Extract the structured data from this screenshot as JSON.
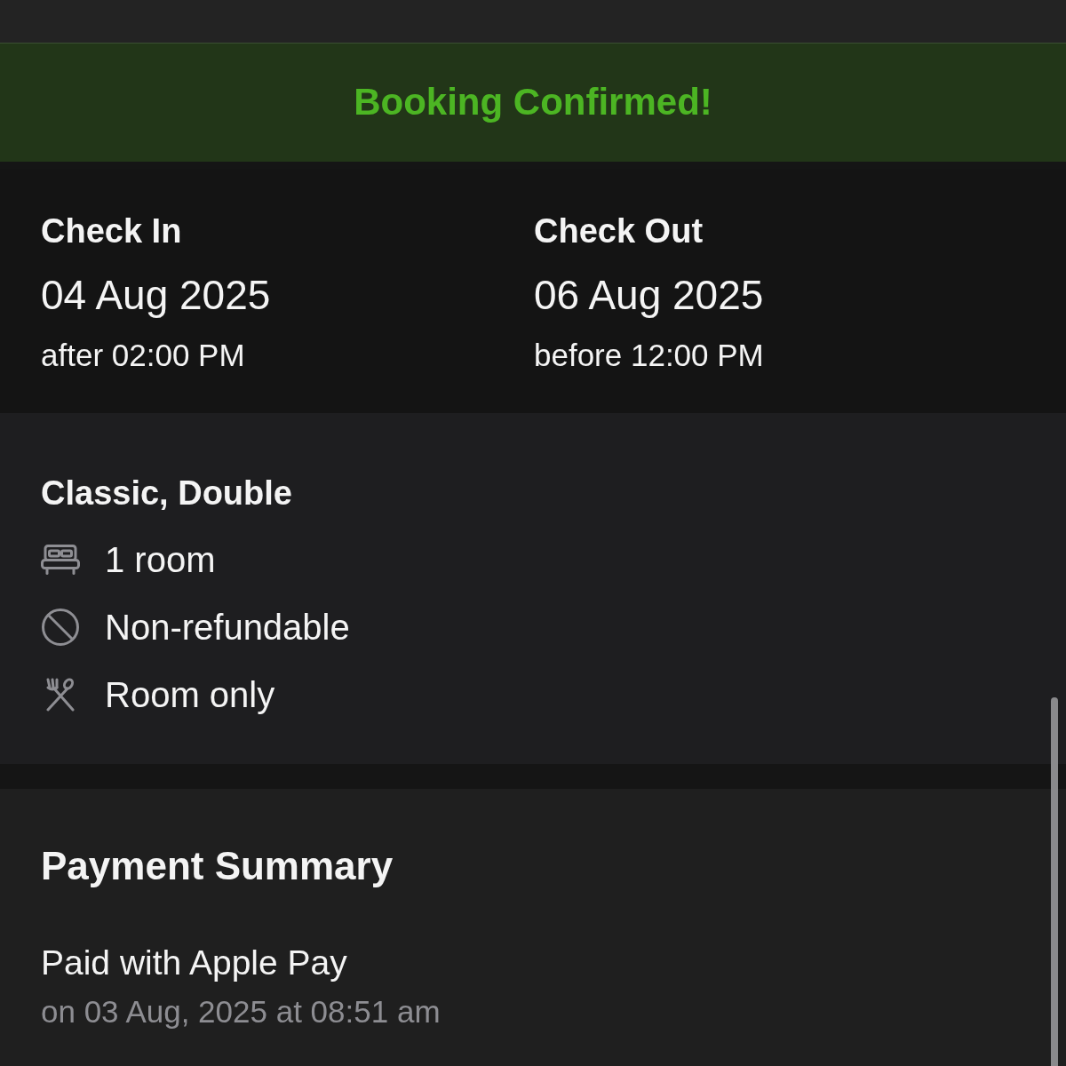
{
  "banner": {
    "title": "Booking Confirmed!"
  },
  "stay": [
    {
      "label": "Check In",
      "date": "04 Aug 2025",
      "time": "after 02:00 PM"
    },
    {
      "label": "Check Out",
      "date": "06 Aug 2025",
      "time": "before 12:00 PM"
    }
  ],
  "room": {
    "title": "Classic, Double",
    "features": [
      {
        "kind": "bed",
        "text": "1 room"
      },
      {
        "kind": "no-refund",
        "text": "Non-refundable"
      },
      {
        "kind": "no-meal",
        "text": "Room only"
      }
    ]
  },
  "payment": {
    "title": "Payment Summary",
    "method": "Paid with Apple Pay",
    "date": "on 03 Aug, 2025 at 08:51 am"
  }
}
